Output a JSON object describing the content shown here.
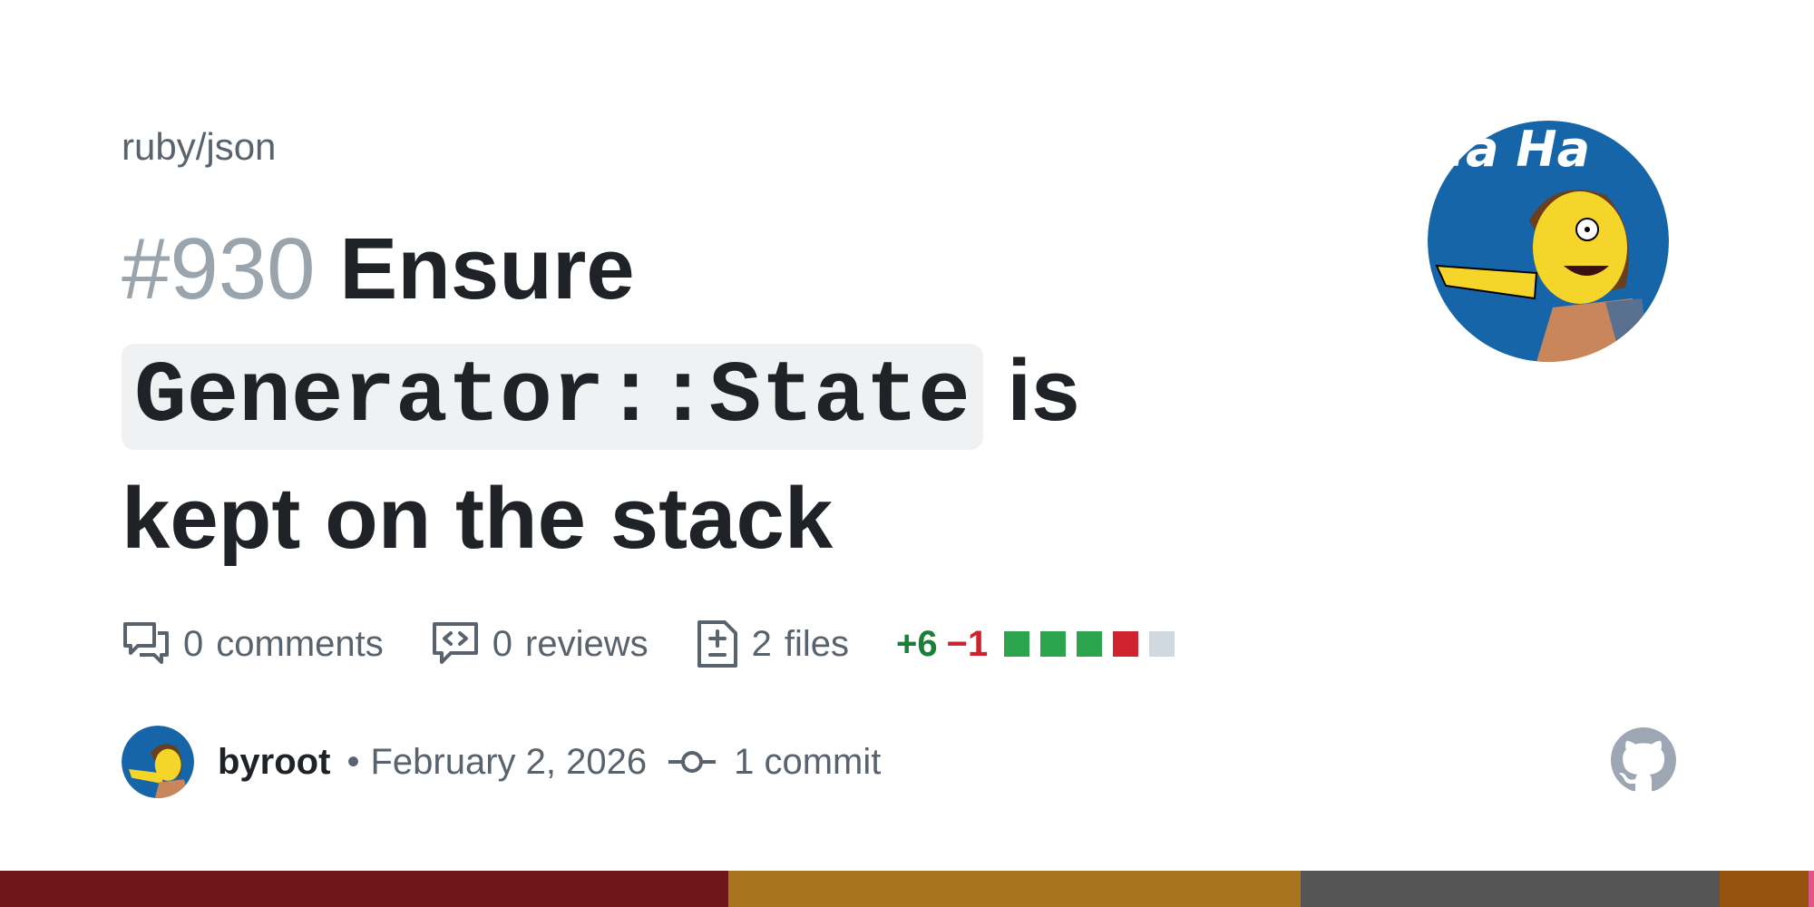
{
  "repo": "ruby/json",
  "pr": {
    "number": "#930",
    "title_part1": "Ensure",
    "title_code": "Generator::State",
    "title_part2": "is",
    "title_part3": "kept on the stack"
  },
  "stats": {
    "comments_count": "0",
    "comments_label": "comments",
    "reviews_count": "0",
    "reviews_label": "reviews",
    "files_count": "2",
    "files_label": "files",
    "additions": "+6",
    "deletions": "−1",
    "diff_blocks": [
      "add",
      "add",
      "add",
      "del",
      "neutral"
    ]
  },
  "author": {
    "name": "byroot",
    "separator": "•",
    "date": "February 2, 2026",
    "commits": "1 commit"
  },
  "avatar_text": "Ha Ha",
  "icons": [
    "comment-icon",
    "review-icon",
    "file-diff-icon",
    "commit-icon",
    "github-logo"
  ],
  "colors": {
    "additions": "#1a7f37",
    "deletions": "#cf222e",
    "add_block": "#2da44e",
    "del_block": "#cf222e",
    "neutral_block": "#d1d9e0",
    "footer": [
      "#6e1619",
      "#a8741e",
      "#555555",
      "#96530f",
      "#e0578a"
    ]
  }
}
